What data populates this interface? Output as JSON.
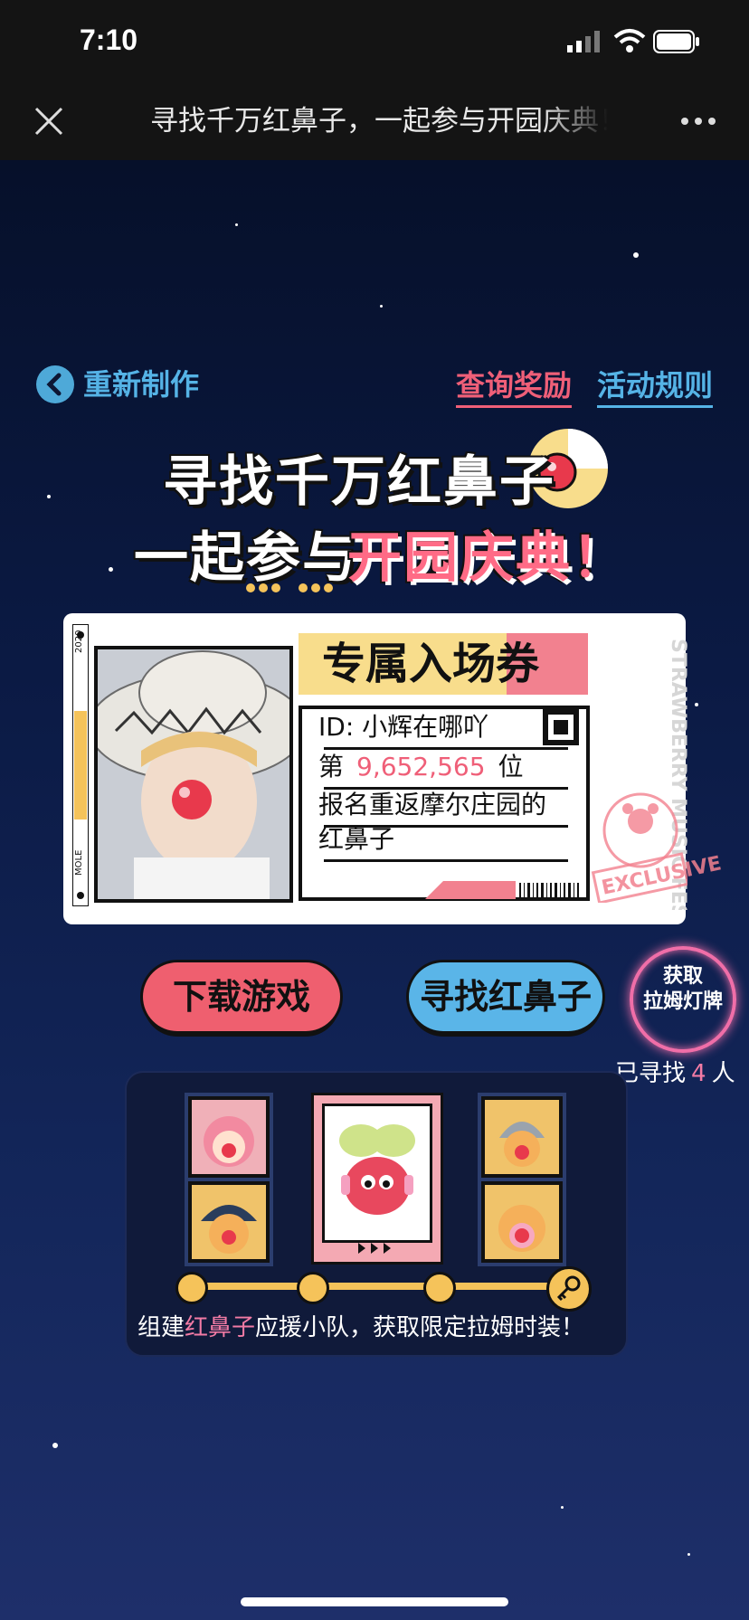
{
  "status_bar": {
    "time": "7:10"
  },
  "nav": {
    "title": "寻找千万红鼻子，一起参与开园庆典！"
  },
  "links": {
    "remake": "重新制作",
    "query_reward": "查询奖励",
    "rules": "活动规则"
  },
  "headline": {
    "line1": "寻找千万红鼻子",
    "line2a": "一起参与",
    "line2b": "开园庆典！"
  },
  "ticket": {
    "title": "专属入场券",
    "id_text": "ID: 小辉在哪吖",
    "rank_prefix": "第",
    "rank_number": "9,652,565",
    "rank_suffix": "位",
    "reg_line1": "报名重返摩尔庄园的",
    "reg_line2": "红鼻子",
    "side_text": "STRAWBERRY MUSIC FESTIVAL",
    "year": "2020",
    "brand": "MOLE",
    "stamp": "EXCLUSIVE"
  },
  "buttons": {
    "download": "下载游戏",
    "find": "寻找红鼻子",
    "lantern_line1": "获取",
    "lantern_line2": "拉姆灯牌"
  },
  "found": {
    "prefix": "已寻找",
    "count": "4",
    "suffix": "人"
  },
  "team": {
    "text_prefix": "组建",
    "text_highlight": "红鼻子",
    "text_suffix": "应援小队，获取限定拉姆时装！"
  },
  "colors": {
    "pink": "#ef5f78",
    "blue": "#55b3e6",
    "yellow": "#f5c35a",
    "bg_dark": "#0d1633"
  },
  "icons": [
    "close-icon",
    "more-icon",
    "back-chevron-icon",
    "qr-code-icon",
    "key-icon",
    "signal-icon",
    "wifi-icon",
    "battery-icon"
  ]
}
